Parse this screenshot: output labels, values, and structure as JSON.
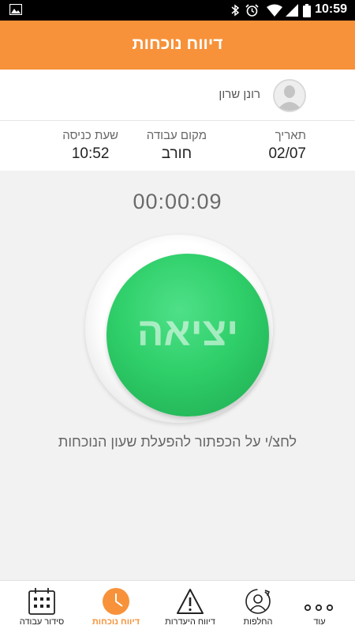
{
  "status_bar": {
    "time": "10:59",
    "icons": [
      "image-icon",
      "bluetooth-icon",
      "alarm-icon",
      "wifi-icon",
      "signal-icon",
      "battery-icon"
    ]
  },
  "app_bar": {
    "title": "דיווח נוכחות",
    "color": "#f7923a"
  },
  "user": {
    "name": "רונן שרון",
    "avatar_icon": "user-avatar-icon"
  },
  "info": {
    "date": {
      "label": "תאריך",
      "value": "02/07"
    },
    "workplace": {
      "label": "מקום עבודה",
      "value": "חורב"
    },
    "entry_time": {
      "label": "שעת כניסה",
      "value": "10:52"
    }
  },
  "main": {
    "timer": "00:00:09",
    "action_button": {
      "label": "יציאה",
      "color": "#2fcf6a"
    },
    "hint": "לחצ/י על הכפתור להפעלת שעון הנוכחות"
  },
  "bottom_nav": {
    "active_color": "#f7923a",
    "items": [
      {
        "label": "עוד",
        "icon": "more-dots-icon"
      },
      {
        "label": "החלפות",
        "icon": "swap-person-icon"
      },
      {
        "label": "דיווח היעדרות",
        "icon": "warning-icon"
      },
      {
        "label": "דיווח נוכחות",
        "icon": "clock-icon",
        "active": true
      },
      {
        "label": "סידור עבודה",
        "icon": "calendar-icon"
      }
    ]
  }
}
